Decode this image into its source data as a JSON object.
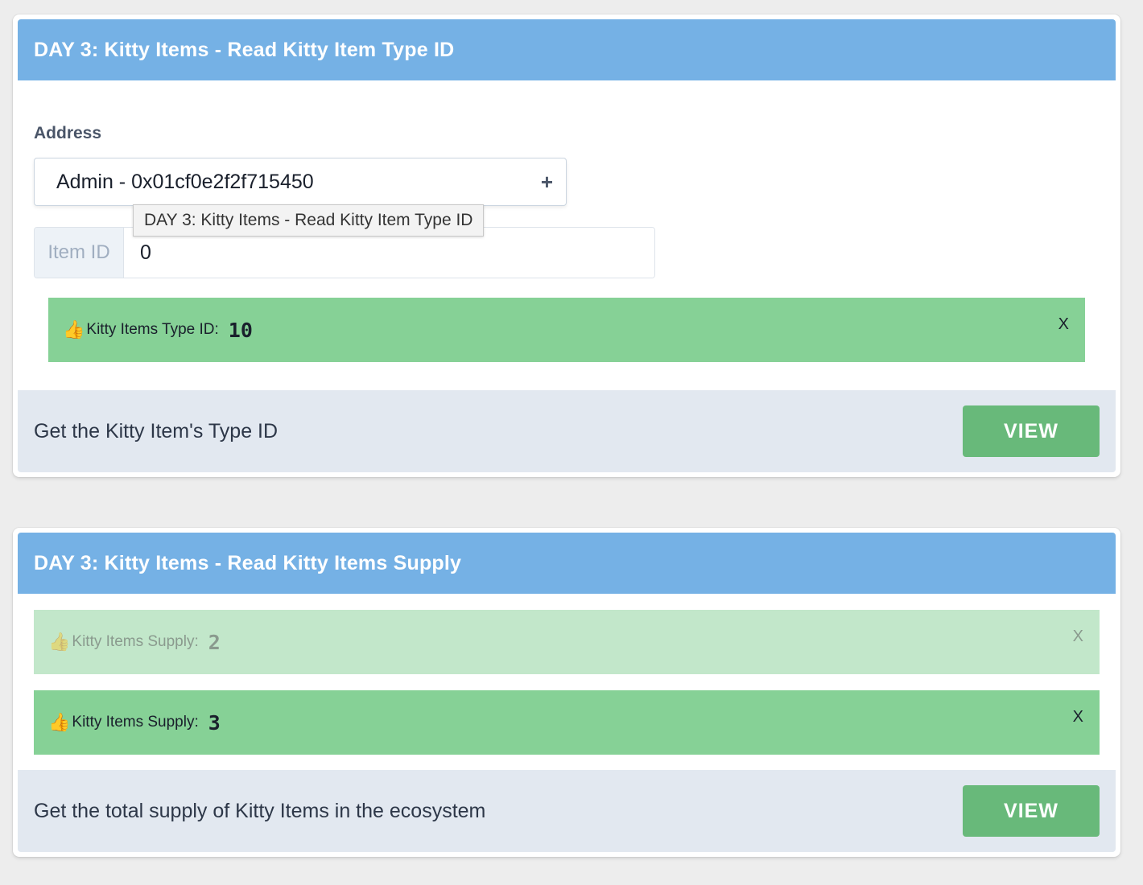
{
  "cards": [
    {
      "title": "DAY 3: Kitty Items - Read Kitty Item Type ID",
      "address_label": "Address",
      "address_value": "Admin - 0x01cf0e2f2f715450",
      "tooltip": "DAY 3: Kitty Items - Read Kitty Item Type ID",
      "item_id_label": "Item ID",
      "item_id_value": "0",
      "results": [
        {
          "label": "Kitty Items Type ID:",
          "value": "10",
          "close": "X"
        }
      ],
      "description": "Get the Kitty Item's Type ID",
      "button_label": "VIEW"
    },
    {
      "title": "DAY 3: Kitty Items - Read Kitty Items Supply",
      "results": [
        {
          "label": "Kitty Items Supply:",
          "value": "2",
          "close": "X",
          "faded": true
        },
        {
          "label": "Kitty Items Supply:",
          "value": "3",
          "close": "X"
        }
      ],
      "description": "Get the total supply of Kitty Items in the ecosystem",
      "button_label": "VIEW"
    }
  ],
  "icons": {
    "thumb": "👍",
    "plus": "+"
  },
  "colors": {
    "header": "#75b1e5",
    "success": "#86d196",
    "success_faded": "#c2e7ca",
    "button": "#68b97a",
    "footer": "#e2e8f0",
    "background": "#ededed"
  }
}
